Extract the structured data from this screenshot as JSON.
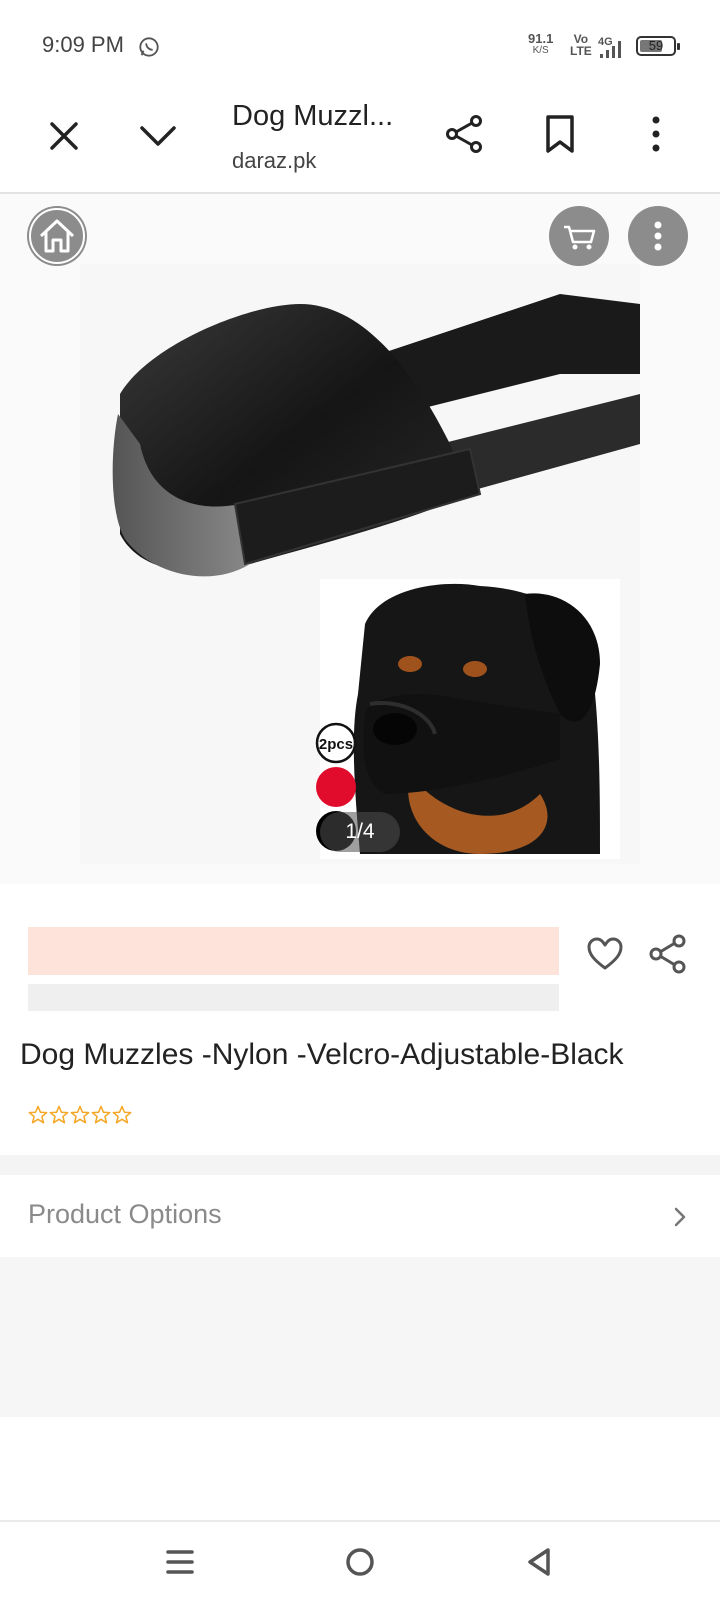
{
  "status_bar": {
    "time": "9:09 PM",
    "net_speed": "91.1",
    "net_speed_unit": "K/S",
    "volte_top": "Vo",
    "volte_bottom": "LTE",
    "network": "4G",
    "battery": "59"
  },
  "browser": {
    "page_title": "Dog Muzzl...",
    "domain": "daraz.pk",
    "icons": [
      "close-icon",
      "chevron-down-icon",
      "share-icon",
      "bookmark-icon",
      "more-vert-icon"
    ]
  },
  "gallery": {
    "pager": "1/4",
    "badge_text": "2pcs",
    "icons": [
      "home-icon",
      "cart-icon",
      "more-vert-icon"
    ]
  },
  "product": {
    "title": "Dog Muzzles -Nylon -Velcro-Adjustable-Black",
    "rating_stars_filled": 0,
    "rating_stars_total": 5,
    "star_color": "#f5a623"
  },
  "options": {
    "label": "Product Options"
  },
  "colors": {
    "promo_bar": "#fde3d9",
    "accent": "#f57224"
  }
}
